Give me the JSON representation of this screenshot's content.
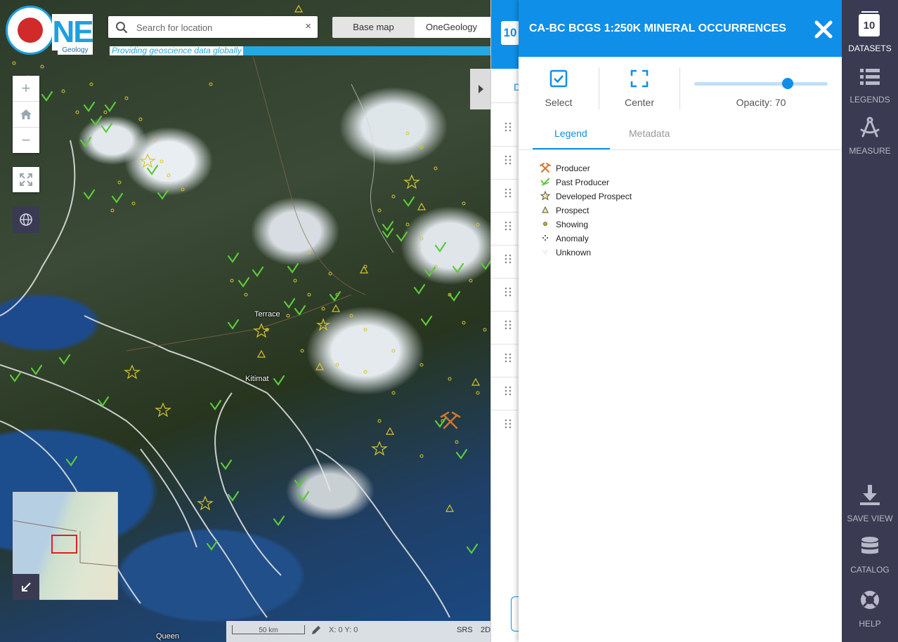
{
  "app": {
    "logo_letters": "NE",
    "logo_sub": "Geology",
    "tagline": "Providing geoscience data globally"
  },
  "search": {
    "placeholder": "Search for location",
    "clear_glyph": "×"
  },
  "basemap": {
    "label": "Base map",
    "value": "OneGeology"
  },
  "map": {
    "place_labels": [
      "Terrace",
      "Kitimat",
      "Queen"
    ],
    "zoom_in": "+",
    "zoom_out": "−",
    "icons": [
      "home-icon",
      "fullscreen-icon",
      "globe-icon",
      "overview-collapse-icon",
      "panel-collapse-icon"
    ]
  },
  "statusbar": {
    "scale_label": "50 km",
    "coords": "X: 0 Y: 0",
    "srs_label": "SRS",
    "srs_value": "2D"
  },
  "layers_panel": {
    "count": "10",
    "tab_letter": "D"
  },
  "detail": {
    "title": "CA-BC BCGS 1:250K MINERAL OCCURRENCES",
    "select_label": "Select",
    "center_label": "Center",
    "opacity_label": "Opacity: 70",
    "opacity_value": 70,
    "tabs": [
      "Legend",
      "Metadata"
    ],
    "active_tab": "Legend",
    "legend": [
      {
        "label": "Producer",
        "icon": "crossed-hammers-icon",
        "color": "#d4762a"
      },
      {
        "label": "Past Producer",
        "icon": "past-producer-icon",
        "color": "#5cc93a"
      },
      {
        "label": "Developed Prospect",
        "icon": "star-icon",
        "color": "#d9c62a"
      },
      {
        "label": "Prospect",
        "icon": "triangle-icon",
        "color": "#d9c62a"
      },
      {
        "label": "Showing",
        "icon": "dot-icon",
        "color": "#d9c62a"
      },
      {
        "label": "Anomaly",
        "icon": "anomaly-icon",
        "color": "#333333"
      },
      {
        "label": "Unknown",
        "icon": "unknown-icon",
        "color": "#bbbbbb"
      }
    ]
  },
  "rail": {
    "datasets_count": "10",
    "datasets": "DATASETS",
    "legends": "LEGENDS",
    "measure": "MEASURE",
    "save_view": "SAVE VIEW",
    "catalog": "CATALOG",
    "help": "HELP"
  },
  "colors": {
    "accent": "#0f8fe8",
    "rail": "#3a3a52",
    "occurrence_yellow": "#d9c62a",
    "past_producer_green": "#5cc93a",
    "producer_orange": "#d4762a"
  }
}
